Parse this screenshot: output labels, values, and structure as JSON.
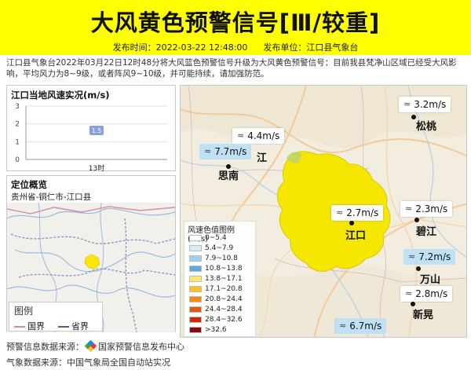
{
  "header": {
    "title": "大风黄色预警信号[Ⅲ/较重]",
    "publish_time_label": "发布时间：2022-03-22 12:48:00",
    "publisher_label": "发布单位：江口县气象台"
  },
  "description": "江口县气象台2022年03月22日12时48分将大风蓝色预警信号升级为大风黄色预警信号：目前我县梵净山区域已经受大风影响，平均风力为8~9级，或者阵风9~10级，并可能持续，请加强防范。",
  "colors": {
    "header_bg": "#ffff00",
    "warning_area": "#f5e700",
    "point_label": "#8aa0d8"
  },
  "wind_chart": {
    "title": "江口当地风速实况(m/s)",
    "chart_data": {
      "type": "line",
      "categories": [
        "13时"
      ],
      "values": [
        1.5
      ],
      "data_labels": [
        "1.5"
      ],
      "yticks": [
        "0",
        "1",
        "2",
        "3"
      ],
      "ylim": [
        0,
        3
      ],
      "grid": true,
      "xlabel": "",
      "ylabel": ""
    }
  },
  "locator": {
    "title": "定位概览",
    "subtitle": "贵州省-铜仁市-江口县",
    "legend_title": "图例",
    "legend_items": [
      "国界",
      "省界"
    ]
  },
  "map": {
    "legend_title": "风速色值图例 (m/s)",
    "legend_rows": [
      {
        "label": "0~5.4",
        "color": "#ffffff"
      },
      {
        "label": "5.4~7.9",
        "color": "#d6ebf7"
      },
      {
        "label": "7.9~10.8",
        "color": "#9fd0ef"
      },
      {
        "label": "10.8~13.8",
        "color": "#5aa8e0"
      },
      {
        "label": "13.8~17.1",
        "color": "#ffe86a"
      },
      {
        "label": "17.1~20.8",
        "color": "#ffc21a"
      },
      {
        "label": "20.8~24.4",
        "color": "#f08c10"
      },
      {
        "label": "24.4~28.4",
        "color": "#e05a10"
      },
      {
        "label": "28.4~32.6",
        "color": "#c82a0a"
      },
      {
        "label": ">32.6",
        "color": "#8c0a0a"
      }
    ],
    "wind_labels": [
      {
        "id": "songtao",
        "value": "3.2m/s",
        "style": "white"
      },
      {
        "id": "yinjiang",
        "value": "4.4m/s",
        "style": "white"
      },
      {
        "id": "sinan",
        "value": "7.7m/s",
        "style": "blue"
      },
      {
        "id": "jiangkou",
        "value": "2.7m/s",
        "style": "white"
      },
      {
        "id": "bijiang",
        "value": "2.3m/s",
        "style": "white"
      },
      {
        "id": "wanshan",
        "value": "7.2m/s",
        "style": "blue"
      },
      {
        "id": "xinhuang",
        "value": "2.8m/s",
        "style": "white"
      },
      {
        "id": "bottom",
        "value": "6.7m/s",
        "style": "blue"
      }
    ],
    "cities": {
      "songtao": "松桃",
      "yinjiang_partial": "江",
      "sinan": "思南",
      "jiangkou": "江口",
      "bijiang": "碧江",
      "wanshan": "万山",
      "xinhuang": "新晃"
    }
  },
  "footer": {
    "warning_source_label": "预警信息数据来源：",
    "warning_source_name": "国家预警信息发布中心",
    "weather_source": "气象数据来源：中国气象局全国自动站实况"
  }
}
